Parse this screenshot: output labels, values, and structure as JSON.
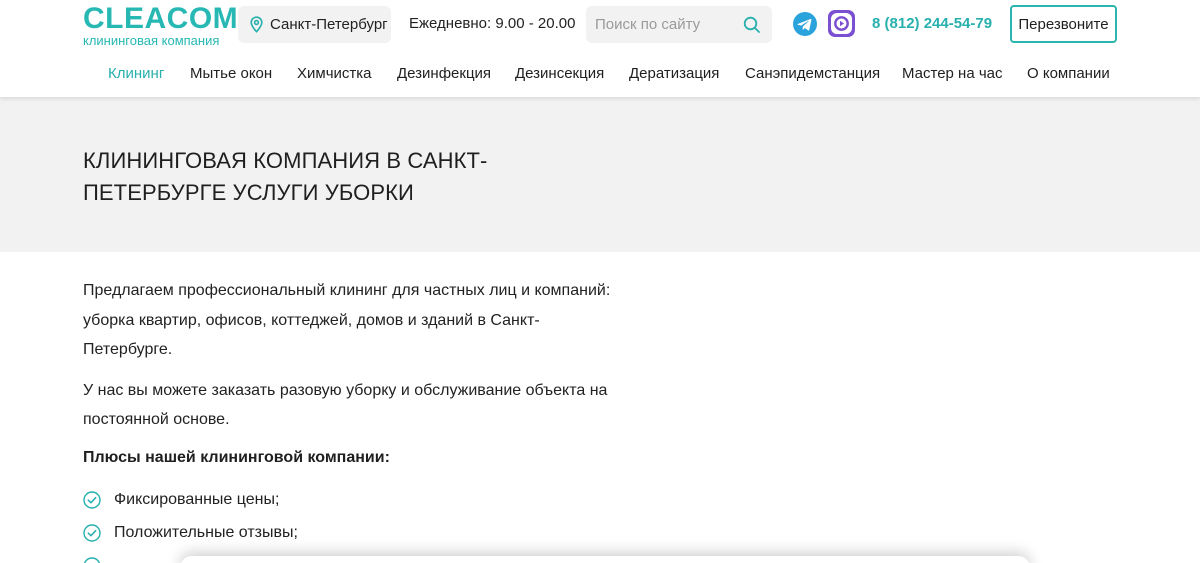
{
  "logo": {
    "word": "CLEACOM",
    "subtitle": "клининговая компания"
  },
  "header": {
    "city": "Санкт-Петербург",
    "hours": "Ежедневно: 9.00 - 20.00",
    "search_placeholder": "Поиск по сайту",
    "search_value": "",
    "phone": "8 (812) 244-54-79",
    "callback_label": "Перезвоните"
  },
  "nav": {
    "items": [
      {
        "label": "Клининг",
        "active": true
      },
      {
        "label": "Мытье окон",
        "active": false
      },
      {
        "label": "Химчистка",
        "active": false
      },
      {
        "label": "Дезинфекция",
        "active": false
      },
      {
        "label": "Дезинсекция",
        "active": false
      },
      {
        "label": "Дератизация",
        "active": false
      },
      {
        "label": "Санэпидемстанция",
        "active": false
      },
      {
        "label": "Мастер на час",
        "active": false
      },
      {
        "label": "О компании",
        "active": false
      }
    ]
  },
  "hero": {
    "title": "КЛИНИНГОВАЯ КОМПАНИЯ В САНКТ-ПЕТЕРБУРГЕ УСЛУГИ УБОРКИ"
  },
  "main": {
    "intro": "Предлагаем профессиональный клининг для частных лиц и компаний: уборка квартир, офисов, коттеджей, домов и зданий в Санкт-Петербурге.",
    "order_text": "У нас вы можете заказать разовую уборку и обслуживание объекта на постоянной основе.",
    "benefits_title": "Плюсы нашей клининговой компании:",
    "benefits": [
      "Фиксированные цены;",
      "Положительные отзывы;",
      ""
    ]
  },
  "colors": {
    "accent": "#27b0ad",
    "hero_bg": "#f2f2f2",
    "telegram": "#2aa3dd",
    "vk": "#7a4fd1"
  },
  "icons": [
    "map-pin-icon",
    "search-icon",
    "telegram-icon",
    "vk-video-icon",
    "check-circle-icon"
  ]
}
